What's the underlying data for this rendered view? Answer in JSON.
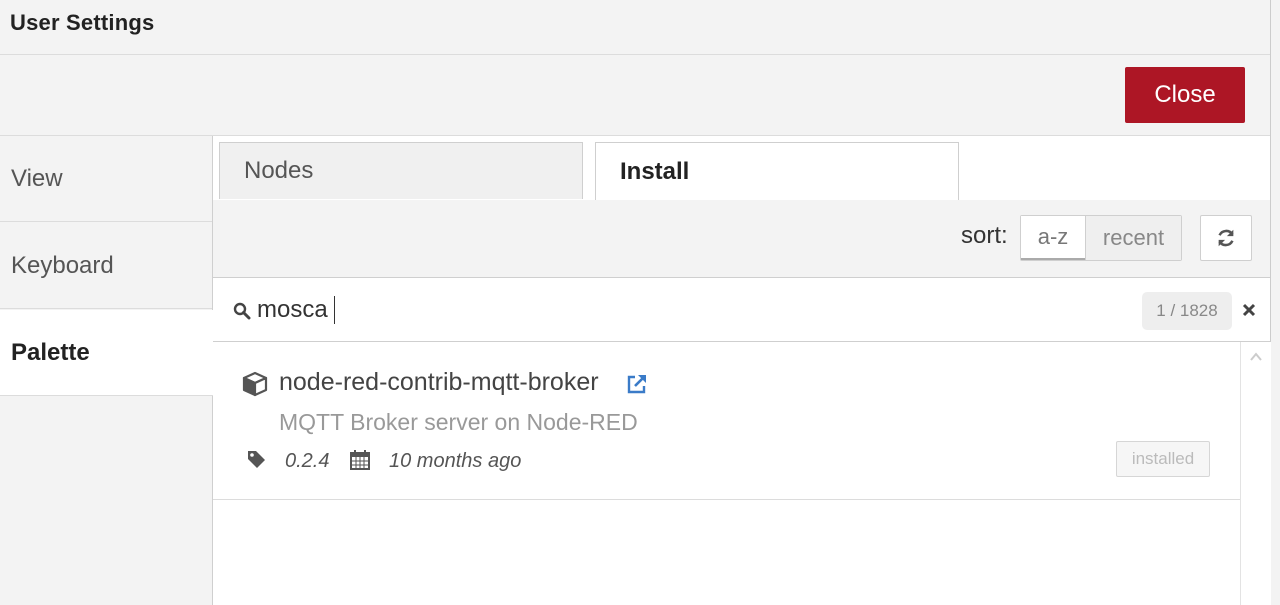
{
  "dialog": {
    "title": "User Settings"
  },
  "toolbar": {
    "close_label": "Close"
  },
  "sidebar": {
    "items": [
      {
        "label": "View",
        "active": false
      },
      {
        "label": "Keyboard",
        "active": false
      },
      {
        "label": "Palette",
        "active": true
      }
    ]
  },
  "tabs": [
    {
      "label": "Nodes",
      "active": false
    },
    {
      "label": "Install",
      "active": true
    }
  ],
  "sort": {
    "label": "sort:",
    "options": [
      "a-z",
      "recent"
    ],
    "selected": "a-z"
  },
  "search": {
    "value": "mosca",
    "count": "1 / 1828"
  },
  "results": [
    {
      "name": "node-red-contrib-mqtt-broker",
      "description": "MQTT Broker server on Node-RED",
      "version": "0.2.4",
      "updated": "10 months ago",
      "status": "installed"
    }
  ],
  "colors": {
    "close_button": "#ad1625",
    "link_icon": "#3a7bc8"
  },
  "icons": {
    "search": "search-icon",
    "refresh": "refresh-icon",
    "clear": "close-icon",
    "package": "cube-icon",
    "external_link": "external-link-icon",
    "tag": "tag-icon",
    "calendar": "calendar-icon",
    "scroll_up": "chevron-up-icon"
  }
}
